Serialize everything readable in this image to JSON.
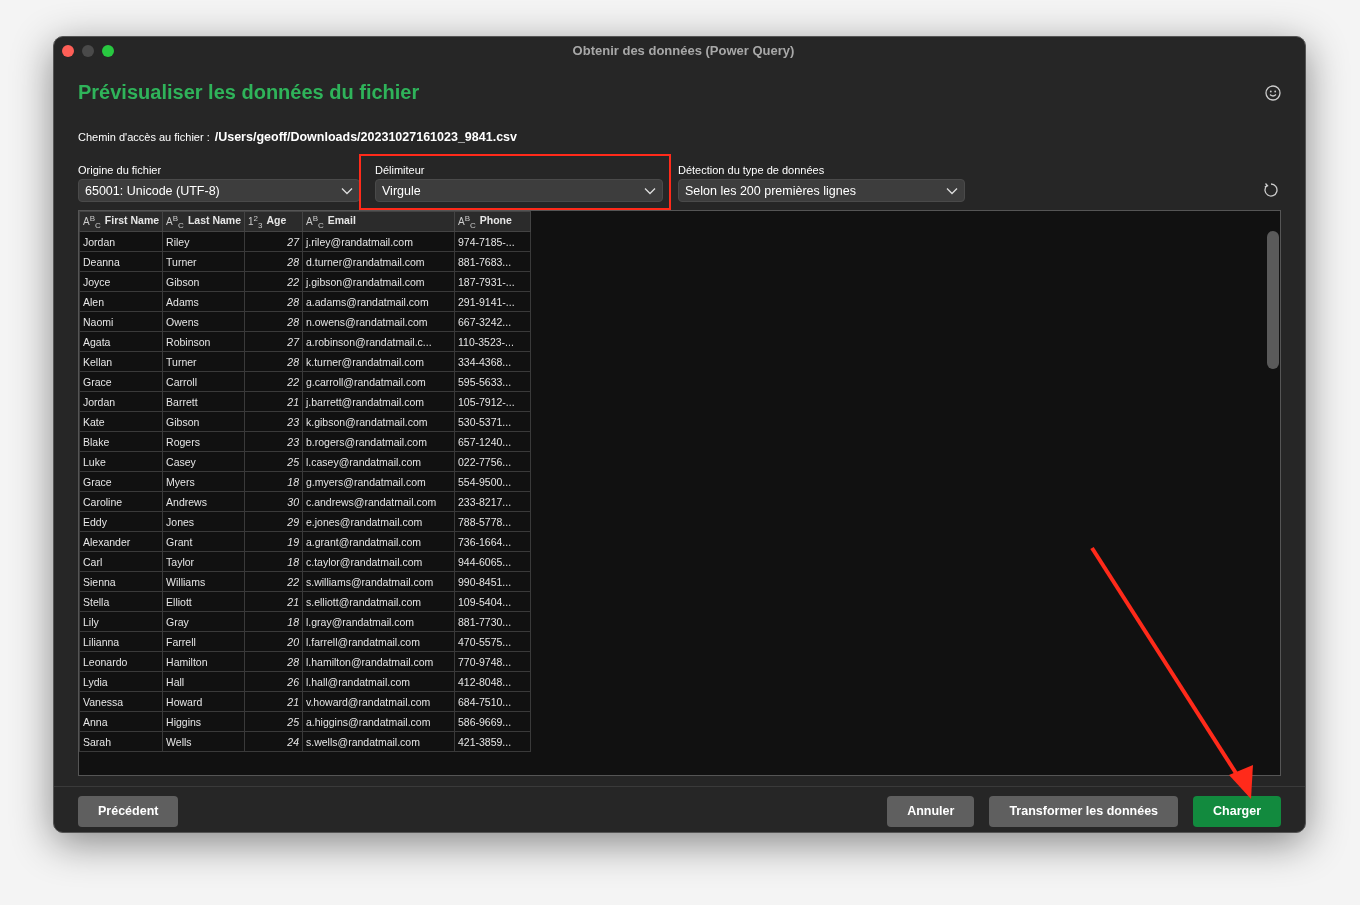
{
  "window": {
    "title": "Obtenir des données (Power Query)"
  },
  "heading": "Prévisualiser les données du fichier",
  "file_path": {
    "label": "Chemin d'accès au fichier :",
    "value": "/Users/geoff/Downloads/20231027161023_9841.csv"
  },
  "options": [
    {
      "label": "Origine du fichier",
      "value": "65001: Unicode (UTF-8)",
      "highlighted": false
    },
    {
      "label": "Délimiteur",
      "value": "Virgule",
      "highlighted": true
    },
    {
      "label": "Détection du type de données",
      "value": "Selon les 200 premières lignes",
      "highlighted": false
    }
  ],
  "table": {
    "columns": [
      {
        "label": "First Name",
        "type_icon": "A$^{B}$$_{C}$",
        "kind": "text"
      },
      {
        "label": "Last Name",
        "type_icon": "A$^{B}$$_{C}$",
        "kind": "text"
      },
      {
        "label": "Age",
        "type_icon": "1$^{2}$$_{3}$",
        "kind": "number"
      },
      {
        "label": "Email",
        "type_icon": "A$^{B}$$_{C}$",
        "kind": "text"
      },
      {
        "label": "Phone",
        "type_icon": "A$^{B}$$_{C}$",
        "kind": "text"
      }
    ],
    "rows": [
      [
        "Jordan",
        "Riley",
        "27",
        "j.riley@randatmail.com",
        "974-7185-..."
      ],
      [
        "Deanna",
        "Turner",
        "28",
        "d.turner@randatmail.com",
        "881-7683..."
      ],
      [
        "Joyce",
        "Gibson",
        "22",
        "j.gibson@randatmail.com",
        "187-7931-..."
      ],
      [
        "Alen",
        "Adams",
        "28",
        "a.adams@randatmail.com",
        "291-9141-..."
      ],
      [
        "Naomi",
        "Owens",
        "28",
        "n.owens@randatmail.com",
        "667-3242..."
      ],
      [
        "Agata",
        "Robinson",
        "27",
        "a.robinson@randatmail.c...",
        "110-3523-..."
      ],
      [
        "Kellan",
        "Turner",
        "28",
        "k.turner@randatmail.com",
        "334-4368..."
      ],
      [
        "Grace",
        "Carroll",
        "22",
        "g.carroll@randatmail.com",
        "595-5633..."
      ],
      [
        "Jordan",
        "Barrett",
        "21",
        "j.barrett@randatmail.com",
        "105-7912-..."
      ],
      [
        "Kate",
        "Gibson",
        "23",
        "k.gibson@randatmail.com",
        "530-5371..."
      ],
      [
        "Blake",
        "Rogers",
        "23",
        "b.rogers@randatmail.com",
        "657-1240..."
      ],
      [
        "Luke",
        "Casey",
        "25",
        "l.casey@randatmail.com",
        "022-7756..."
      ],
      [
        "Grace",
        "Myers",
        "18",
        "g.myers@randatmail.com",
        "554-9500..."
      ],
      [
        "Caroline",
        "Andrews",
        "30",
        "c.andrews@randatmail.com",
        "233-8217..."
      ],
      [
        "Eddy",
        "Jones",
        "29",
        "e.jones@randatmail.com",
        "788-5778..."
      ],
      [
        "Alexander",
        "Grant",
        "19",
        "a.grant@randatmail.com",
        "736-1664..."
      ],
      [
        "Carl",
        "Taylor",
        "18",
        "c.taylor@randatmail.com",
        "944-6065..."
      ],
      [
        "Sienna",
        "Williams",
        "22",
        "s.williams@randatmail.com",
        "990-8451..."
      ],
      [
        "Stella",
        "Elliott",
        "21",
        "s.elliott@randatmail.com",
        "109-5404..."
      ],
      [
        "Lily",
        "Gray",
        "18",
        "l.gray@randatmail.com",
        "881-7730..."
      ],
      [
        "Lilianna",
        "Farrell",
        "20",
        "l.farrell@randatmail.com",
        "470-5575..."
      ],
      [
        "Leonardo",
        "Hamilton",
        "28",
        "l.hamilton@randatmail.com",
        "770-9748..."
      ],
      [
        "Lydia",
        "Hall",
        "26",
        "l.hall@randatmail.com",
        "412-8048..."
      ],
      [
        "Vanessa",
        "Howard",
        "21",
        "v.howard@randatmail.com",
        "684-7510..."
      ],
      [
        "Anna",
        "Higgins",
        "25",
        "a.higgins@randatmail.com",
        "586-9669..."
      ],
      [
        "Sarah",
        "Wells",
        "24",
        "s.wells@randatmail.com",
        "421-3859..."
      ]
    ]
  },
  "buttons": [
    {
      "label": "Précédent",
      "kind": "secondary",
      "pointed": false
    },
    {
      "label": "Annuler",
      "kind": "secondary",
      "pointed": false
    },
    {
      "label": "Transformer les données",
      "kind": "secondary",
      "pointed": false
    },
    {
      "label": "Charger",
      "kind": "primary",
      "pointed": true
    }
  ]
}
